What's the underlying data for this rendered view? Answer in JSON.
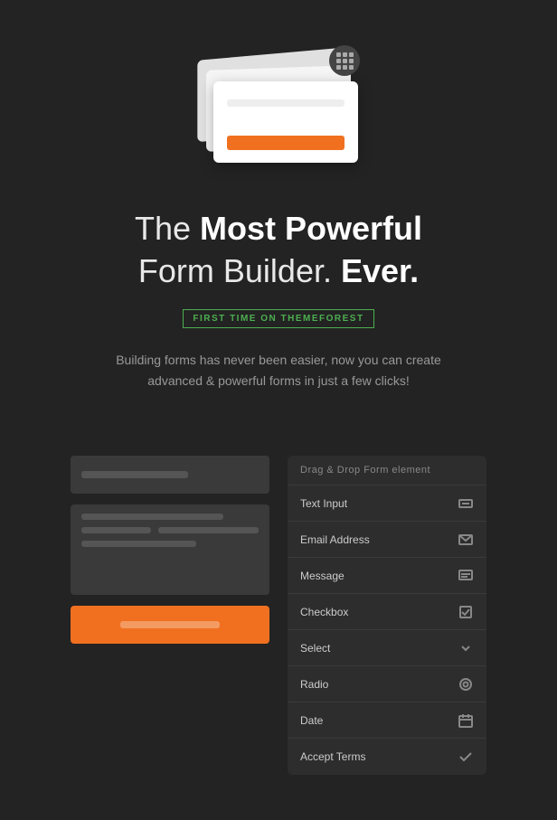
{
  "hero": {
    "title_normal": "The ",
    "title_bold": "Most Powerful",
    "title_line2_normal": "Form Builder. ",
    "title_line2_bold": "Ever.",
    "badge": "FIRST TIME ON THEMEFOREST",
    "subtitle": "Building forms has never been easier, now you can create advanced & powerful forms in just a few clicks!"
  },
  "dnd_panel": {
    "header": "Drag & Drop Form element",
    "items": [
      {
        "label": "Text Input",
        "icon": "text-input-icon"
      },
      {
        "label": "Email Address",
        "icon": "email-icon"
      },
      {
        "label": "Message",
        "icon": "message-icon"
      },
      {
        "label": "Checkbox",
        "icon": "checkbox-icon"
      },
      {
        "label": "Select",
        "icon": "select-icon"
      },
      {
        "label": "Radio",
        "icon": "radio-icon"
      },
      {
        "label": "Date",
        "icon": "date-icon"
      },
      {
        "label": "Accept Terms",
        "icon": "accept-terms-icon"
      }
    ]
  },
  "icons": {
    "grid": "⊞",
    "colors": {
      "orange": "#f07020",
      "green": "#4caf50",
      "dark_bg": "#232323",
      "panel_bg": "#2d2d2d",
      "input_bg": "#3a3a3a"
    }
  }
}
